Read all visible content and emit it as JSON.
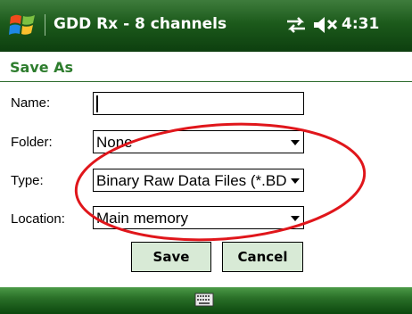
{
  "titlebar": {
    "app_title": "GDD Rx - 8 channels",
    "time": "4:31",
    "icons": [
      "windows-start-icon",
      "connectivity-icon",
      "volume-muted-icon"
    ]
  },
  "dialog": {
    "title": "Save As",
    "fields": {
      "name": {
        "label": "Name:",
        "value": ""
      },
      "folder": {
        "label": "Folder:",
        "value": "None"
      },
      "type": {
        "label": "Type:",
        "value": "Binary Raw Data Files (*.BD"
      },
      "location": {
        "label": "Location:",
        "value": "Main memory"
      }
    },
    "buttons": {
      "save": "Save",
      "cancel": "Cancel"
    }
  },
  "bottombar": {
    "icons": [
      "keyboard-icon"
    ]
  },
  "colors": {
    "titlebar_green": "#1c5a1b",
    "header_text_green": "#2e7d2e",
    "button_fill": "#d8ead6",
    "annotation_red": "#e0161b"
  }
}
